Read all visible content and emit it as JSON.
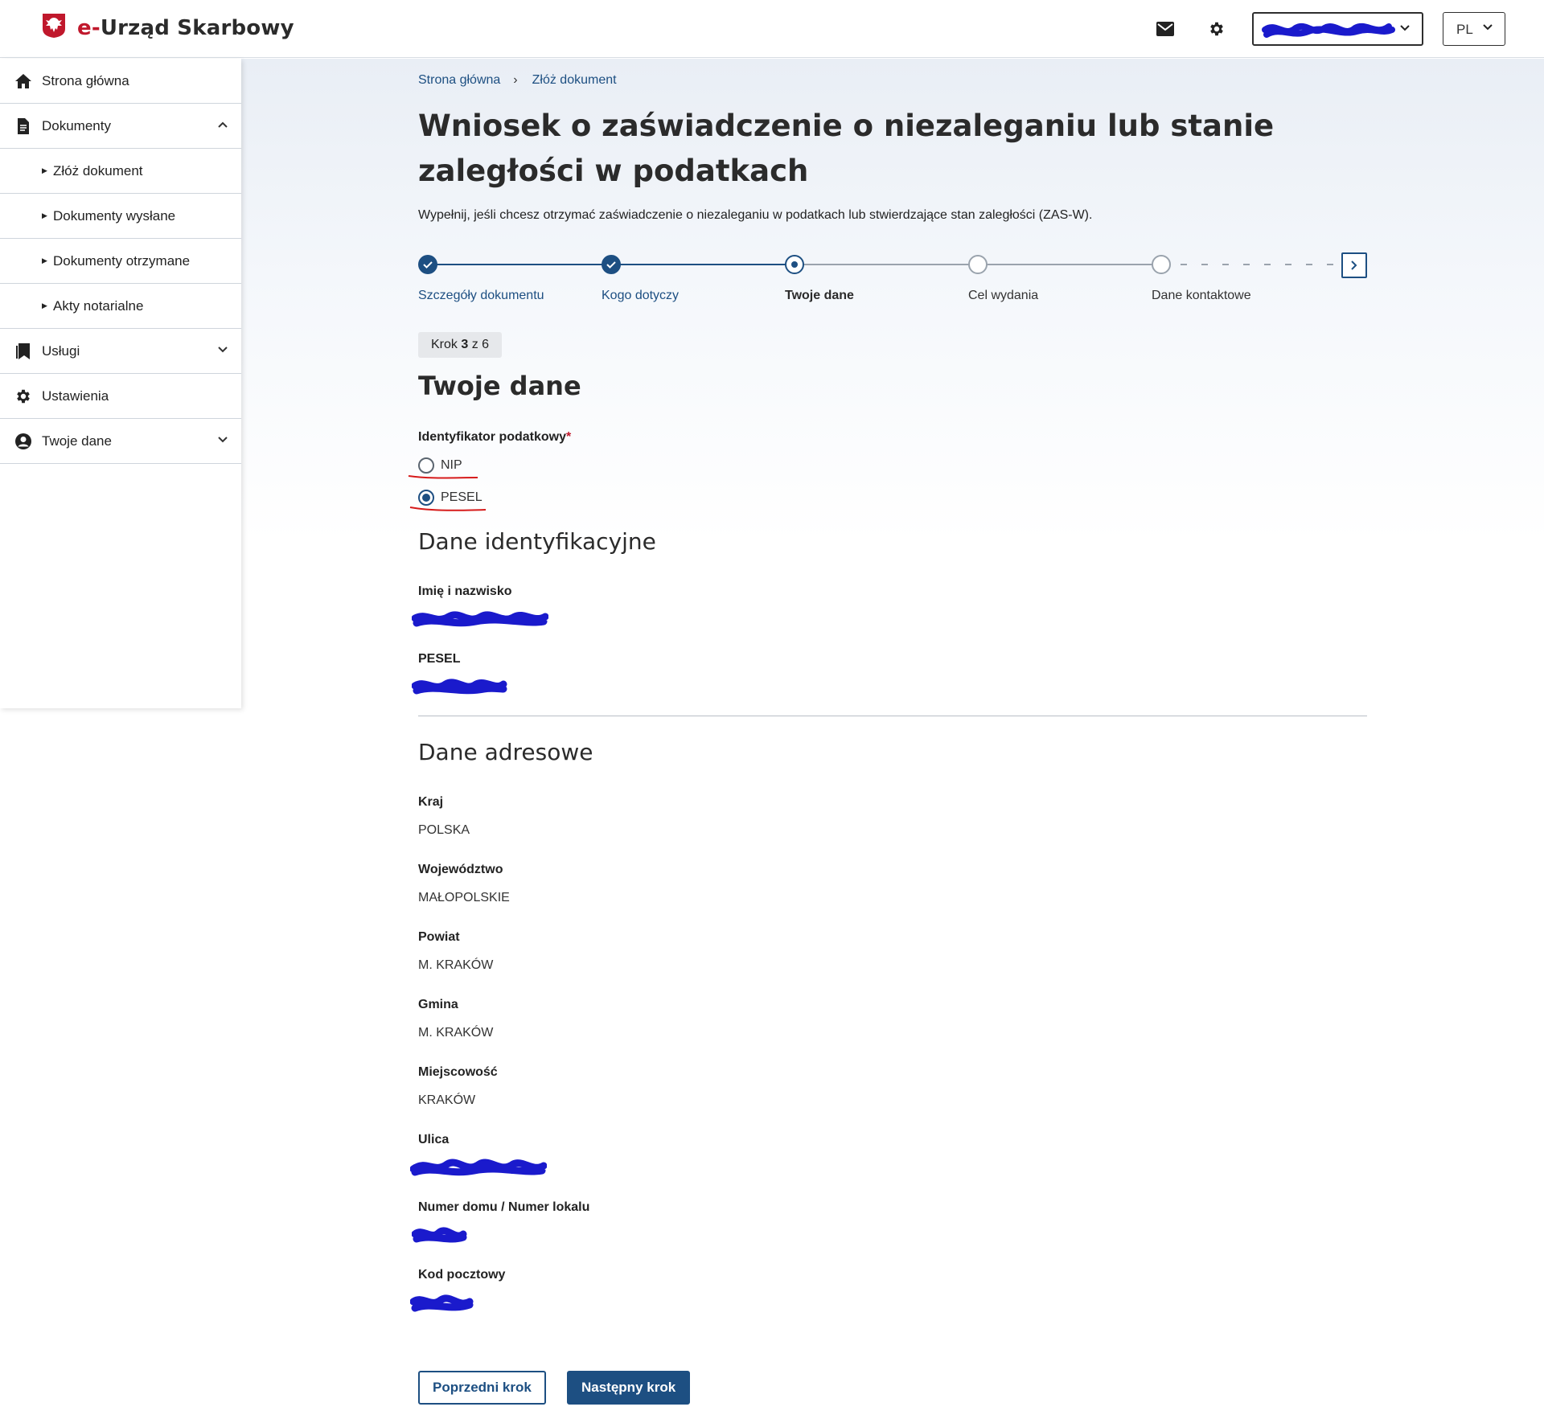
{
  "header": {
    "logo_prefix": "e-",
    "logo_text": "Urząd Skarbowy",
    "mail_icon": "mail-icon",
    "settings_icon": "gear-icon",
    "lang_value": "PL"
  },
  "sidebar": {
    "items": [
      {
        "label": "Strona główna",
        "icon": "home-icon"
      },
      {
        "label": "Dokumenty",
        "icon": "document-icon",
        "expanded": true
      },
      {
        "label": "Złóż dokument",
        "sub": true
      },
      {
        "label": "Dokumenty wysłane",
        "sub": true
      },
      {
        "label": "Dokumenty otrzymane",
        "sub": true
      },
      {
        "label": "Akty notarialne",
        "sub": true
      },
      {
        "label": "Usługi",
        "icon": "bookmark-icon",
        "expanded": false
      },
      {
        "label": "Ustawienia",
        "icon": "gear-icon"
      },
      {
        "label": "Twoje dane",
        "icon": "user-icon",
        "expanded": false
      }
    ]
  },
  "breadcrumb": [
    "Strona główna",
    "Złóż dokument"
  ],
  "page": {
    "title": "Wniosek o zaświadczenie o niezaleganiu lub stanie zaległości w podatkach",
    "description": "Wypełnij, jeśli chcesz otrzymać zaświadczenie o niezaleganiu w podatkach lub stwierdzające stan zaległości (ZAS-W)."
  },
  "stepper": {
    "steps": [
      {
        "label": "Szczegóły dokumentu",
        "state": "done"
      },
      {
        "label": "Kogo dotyczy",
        "state": "done"
      },
      {
        "label": "Twoje dane",
        "state": "current"
      },
      {
        "label": "Cel wydania",
        "state": "todo"
      },
      {
        "label": "Dane kontaktowe",
        "state": "todo"
      }
    ],
    "badge_prefix": "Krok",
    "badge_current": "3",
    "badge_suffix": "z 6"
  },
  "section": {
    "title": "Twoje dane",
    "tax_id_label": "Identyfikator podatkowy",
    "required_mark": "*",
    "tax_id_options": [
      "NIP",
      "PESEL"
    ],
    "tax_id_selected": "PESEL"
  },
  "identification": {
    "title": "Dane identyfikacyjne",
    "name_label": "Imię i nazwisko",
    "pesel_label": "PESEL"
  },
  "address": {
    "title": "Dane adresowe",
    "country_label": "Kraj",
    "country_value": "POLSKA",
    "voivodeship_label": "Województwo",
    "voivodeship_value": "MAŁOPOLSKIE",
    "county_label": "Powiat",
    "county_value": "M. KRAKÓW",
    "commune_label": "Gmina",
    "commune_value": "M. KRAKÓW",
    "city_label": "Miejscowość",
    "city_value": "KRAKÓW",
    "street_label": "Ulica",
    "house_label": "Numer domu / Numer lokalu",
    "postal_label": "Kod pocztowy"
  },
  "buttons": {
    "previous": "Poprzedni krok",
    "next": "Następny krok"
  },
  "colors": {
    "primary": "#1d4f82",
    "brand_red": "#c0182c",
    "redaction": "#1a1acc"
  }
}
